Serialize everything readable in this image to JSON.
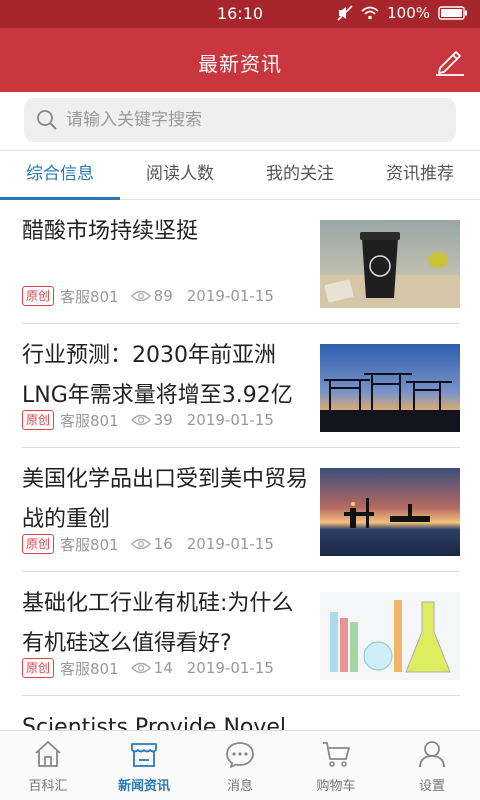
{
  "status_bar": {
    "time": "16:10",
    "battery": "100%"
  },
  "header": {
    "title": "最新资讯",
    "edit_icon": "pencil-icon"
  },
  "search": {
    "placeholder": "请输入关键字搜索",
    "value": ""
  },
  "tabs": [
    {
      "label": "综合信息",
      "active": true
    },
    {
      "label": "阅读人数",
      "active": false
    },
    {
      "label": "我的关注",
      "active": false
    },
    {
      "label": "资讯推荐",
      "active": false
    }
  ],
  "news": [
    {
      "title": "醋酸市场持续坚挺",
      "badge": "原创",
      "author": "客服801",
      "views": "89",
      "date": "2019-01-15",
      "image": "coffee-cup-photo"
    },
    {
      "title": "行业预测：2030年前亚洲LNG年需求量将增至3.92亿",
      "badge": "原创",
      "author": "客服801",
      "views": "39",
      "date": "2019-01-15",
      "image": "port-cranes-sunset-photo"
    },
    {
      "title": "美国化学品出口受到美中贸易战的重创",
      "badge": "原创",
      "author": "客服801",
      "views": "16",
      "date": "2019-01-15",
      "image": "oil-platform-sunset-photo"
    },
    {
      "title": "基础化工行业有机硅:为什么有机硅这么值得看好?",
      "badge": "原创",
      "author": "客服801",
      "views": "14",
      "date": "2019-01-15",
      "image": "lab-glassware-photo"
    },
    {
      "title": "Scientists Provide Novel",
      "badge": "",
      "author": "",
      "views": "",
      "date": "",
      "image": "molecule-photo"
    }
  ],
  "bottom_nav": [
    {
      "label": "百科汇",
      "icon": "house-icon",
      "active": false
    },
    {
      "label": "新闻资讯",
      "icon": "store-icon",
      "active": true
    },
    {
      "label": "消息",
      "icon": "chat-icon",
      "active": false
    },
    {
      "label": "购物车",
      "icon": "cart-icon",
      "active": false
    },
    {
      "label": "设置",
      "icon": "user-icon",
      "active": false
    }
  ],
  "colors": {
    "header": "#c9363d",
    "status_bar": "#a6262c",
    "accent": "#2a78b8",
    "badge": "#d8464c"
  }
}
